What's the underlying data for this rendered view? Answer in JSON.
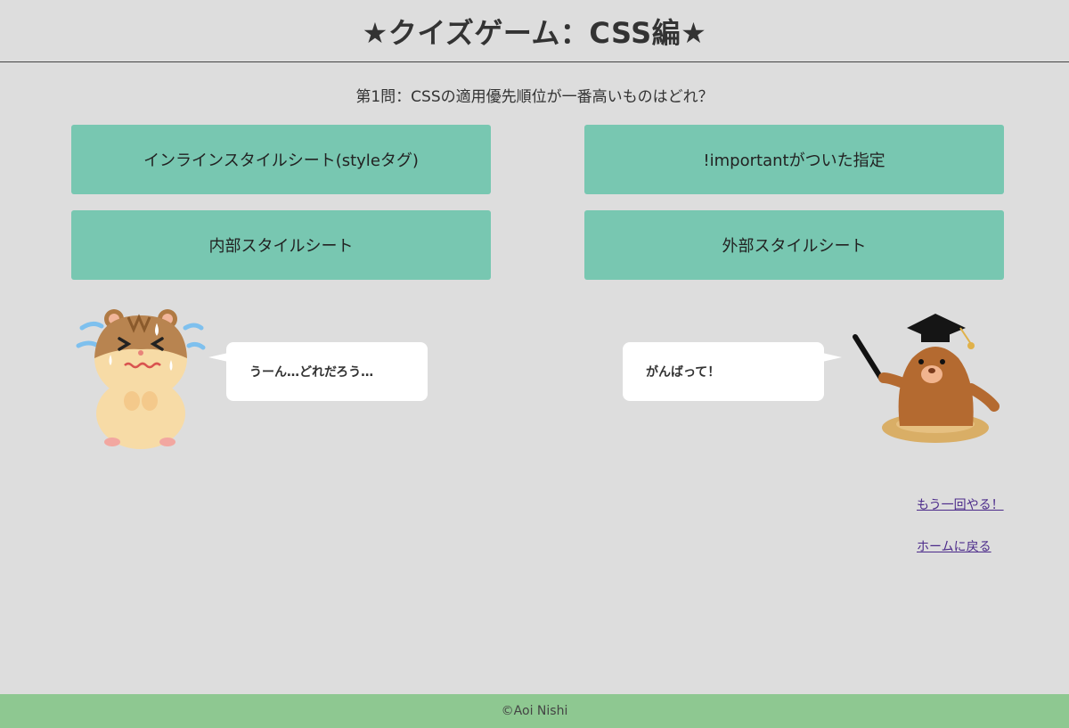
{
  "header": {
    "title": "★クイズゲーム：CSS編★"
  },
  "quiz": {
    "question": "第1問：CSSの適用優先順位が一番高いものはどれ？",
    "choices": [
      "インラインスタイルシート(styleタグ)",
      "!importantがついた指定",
      "内部スタイルシート",
      "外部スタイルシート"
    ]
  },
  "characters": {
    "left": {
      "icon": "hamster-worried-icon",
      "speech": "うーん…どれだろう…"
    },
    "right": {
      "icon": "mole-graduate-icon",
      "speech": "がんばって！"
    }
  },
  "links": {
    "retry": "もう一回やる！",
    "home": "ホームに戻る"
  },
  "footer": {
    "copyright": "©Aoi Nishi"
  },
  "colors": {
    "background": "#dddddd",
    "choice_button": "#78c7b1",
    "footer": "#8ec891",
    "link": "#4b2a8a"
  }
}
